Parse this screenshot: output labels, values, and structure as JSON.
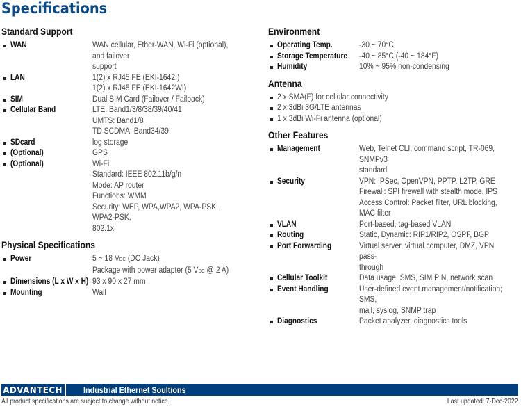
{
  "title": "Specifications",
  "left_column": [
    {
      "section": "Standard Support",
      "items": [
        {
          "label": "WAN",
          "value": [
            "WAN cellular, Ether-WAN, Wi-Fi (optional), and failover",
            "support"
          ]
        },
        {
          "label": "LAN",
          "value": [
            "1(2) x RJ45 FE (EKI-1642I)",
            "1(2) x RJ45 FE (EKI-1642WI)"
          ]
        },
        {
          "label": "SIM",
          "value": [
            "Dual SIM Card (Failover / Failback)"
          ]
        },
        {
          "label": "Cellular Band",
          "value": [
            "LTE: Band1/3/8/38/39/40/41",
            "UMTS: Band1/8",
            "TD SCDMA: Band34/39"
          ]
        },
        {
          "label": "SDcard",
          "value": [
            "log storage"
          ]
        },
        {
          "label": "(Optional)",
          "value": [
            "GPS"
          ]
        },
        {
          "label": "(Optional)",
          "value": [
            "Wi-Fi",
            "Standard: IEEE 802.11b/g/n",
            "Mode: AP router",
            "Functions: WMM",
            "Security: WEP, WPA,WPA2, WPA-PSK, WPA2-PSK,",
            "802.1x"
          ]
        }
      ]
    },
    {
      "section": "Physical Specifications",
      "items": [
        {
          "label": "Power",
          "value_rich": [
            {
              "pre": "5 ~ 18 V",
              "sub": "DC",
              "post": " (DC Jack)"
            },
            {
              "pre": "Package with power adapter (5 V",
              "sub": "DC",
              "post": " @ 2 A)"
            }
          ]
        },
        {
          "label": "Dimensions (L x W x H)",
          "value": [
            "93 x 90 x 27 mm"
          ]
        },
        {
          "label": "Mounting",
          "value": [
            "Wall"
          ]
        }
      ]
    }
  ],
  "right_column": [
    {
      "section": "Environment",
      "items": [
        {
          "label": "Operating Temp.",
          "value": [
            "-30 ~ 70°C"
          ]
        },
        {
          "label": "Storage Temperature",
          "value": [
            "-40 ~ 85°C (-40 ~ 184°F)"
          ]
        },
        {
          "label": "Humidity",
          "value": [
            "10% ~ 95% non-condensing"
          ]
        }
      ]
    },
    {
      "section": "Antenna",
      "bullets": [
        "2 x SMA(F) for cellular connectivity",
        "2 x 3dBi 3G/LTE antennas",
        "1 x 3dBi Wi-Fi antenna (optional)"
      ]
    },
    {
      "section": "Other Features",
      "items": [
        {
          "label": "Management",
          "value": [
            "Web, Telnet CLI, command script, TR-069, SNMPv3",
            "standard"
          ]
        },
        {
          "label": "Security",
          "value": [
            "VPN: IPSec, OpenVPN, PPTP, L2TP, GRE",
            "Firewall: SPI firewall with stealth mode, IPS",
            "Access Control: Packet filter, URL blocking, MAC filter"
          ]
        },
        {
          "label": "VLAN",
          "value": [
            "Port-based, tag-based VLAN"
          ]
        },
        {
          "label": "Routing",
          "value": [
            "Static, Dynamic: RIP1/RIP2, OSPF, BGP"
          ]
        },
        {
          "label": "Port Forwarding",
          "value": [
            "Virtual server, virtual computer, DMZ, VPN pass-",
            "through"
          ]
        },
        {
          "label": "Cellular Toolkit",
          "value": [
            "Data usage, SMS, SIM PIN, network scan"
          ]
        },
        {
          "label": "Event Handling",
          "value": [
            "User-defined event management/notification; SMS,",
            "mail, syslog, SNMP trap"
          ]
        },
        {
          "label": "Diagnostics",
          "value": [
            "Packet analyzer, diagnostics tools"
          ]
        }
      ]
    }
  ],
  "footer": {
    "logo": "ADVANTECH",
    "title": "Industrial Ethernet Soultions",
    "notice": "All product specifications are subject to change without notice.",
    "updated": "Last updated: 7-Dec-2022"
  },
  "colors": {
    "brand_blue": "#003f7d",
    "title_blue": "#0b4a86"
  }
}
